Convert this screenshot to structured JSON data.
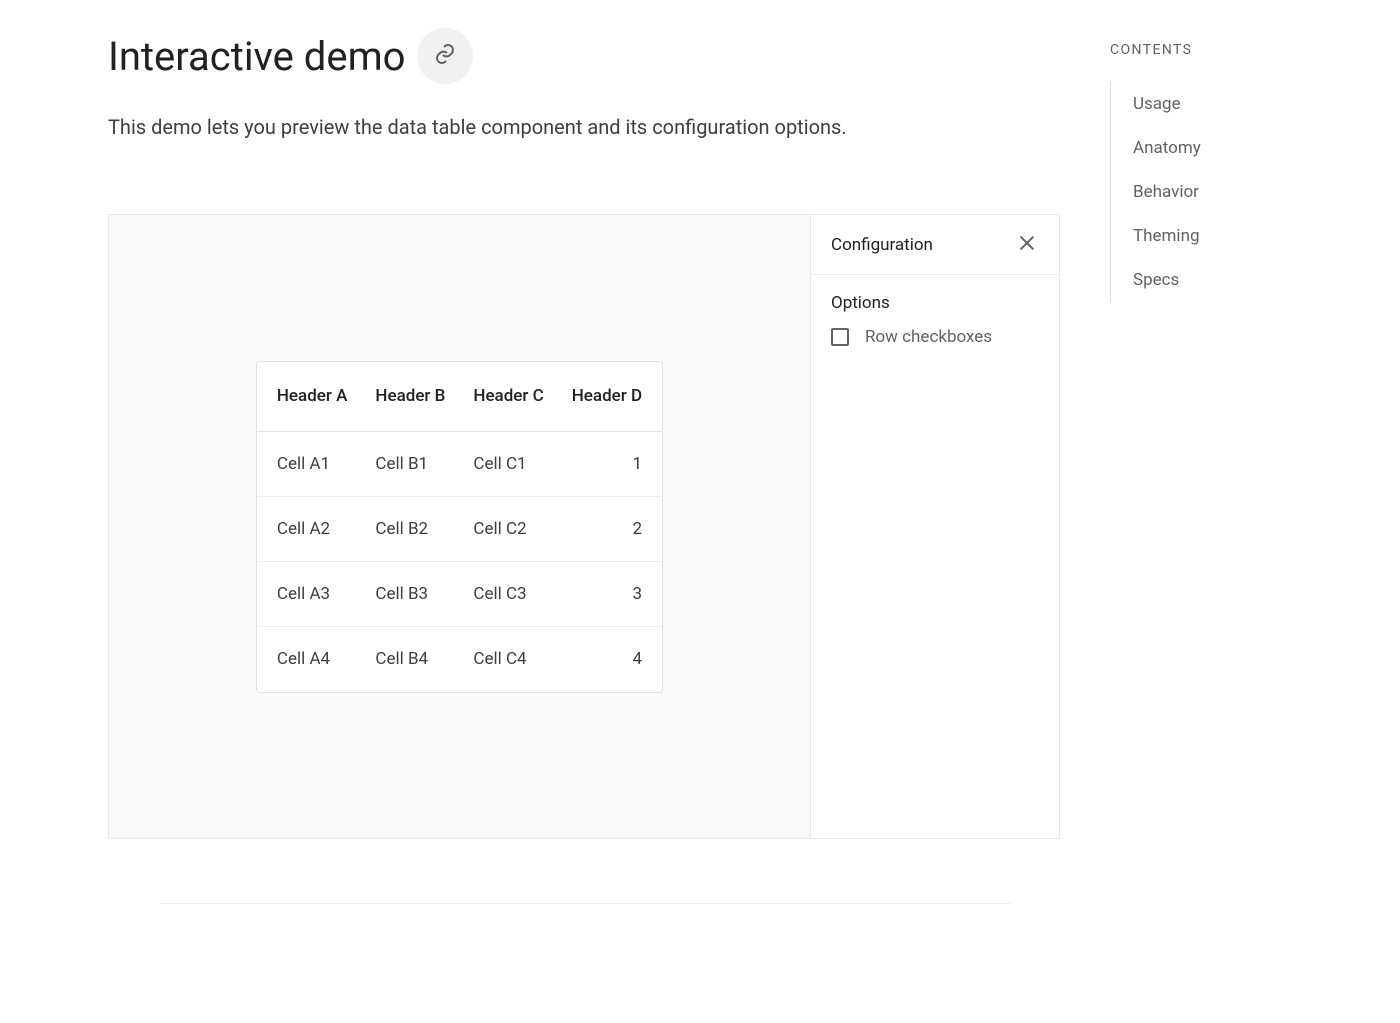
{
  "header": {
    "title": "Interactive demo",
    "intro": "This demo lets you preview the data table component and its configuration options."
  },
  "table": {
    "headers": [
      "Header A",
      "Header B",
      "Header C",
      "Header D"
    ],
    "rows": [
      [
        "Cell A1",
        "Cell B1",
        "Cell C1",
        "1"
      ],
      [
        "Cell A2",
        "Cell B2",
        "Cell C2",
        "2"
      ],
      [
        "Cell A3",
        "Cell B3",
        "Cell C3",
        "3"
      ],
      [
        "Cell A4",
        "Cell B4",
        "Cell C4",
        "4"
      ]
    ]
  },
  "config": {
    "title": "Configuration",
    "options_label": "Options",
    "options": [
      {
        "label": "Row checkboxes",
        "checked": false
      }
    ]
  },
  "toc": {
    "title": "Contents",
    "items": [
      "Usage",
      "Anatomy",
      "Behavior",
      "Theming",
      "Specs"
    ]
  }
}
